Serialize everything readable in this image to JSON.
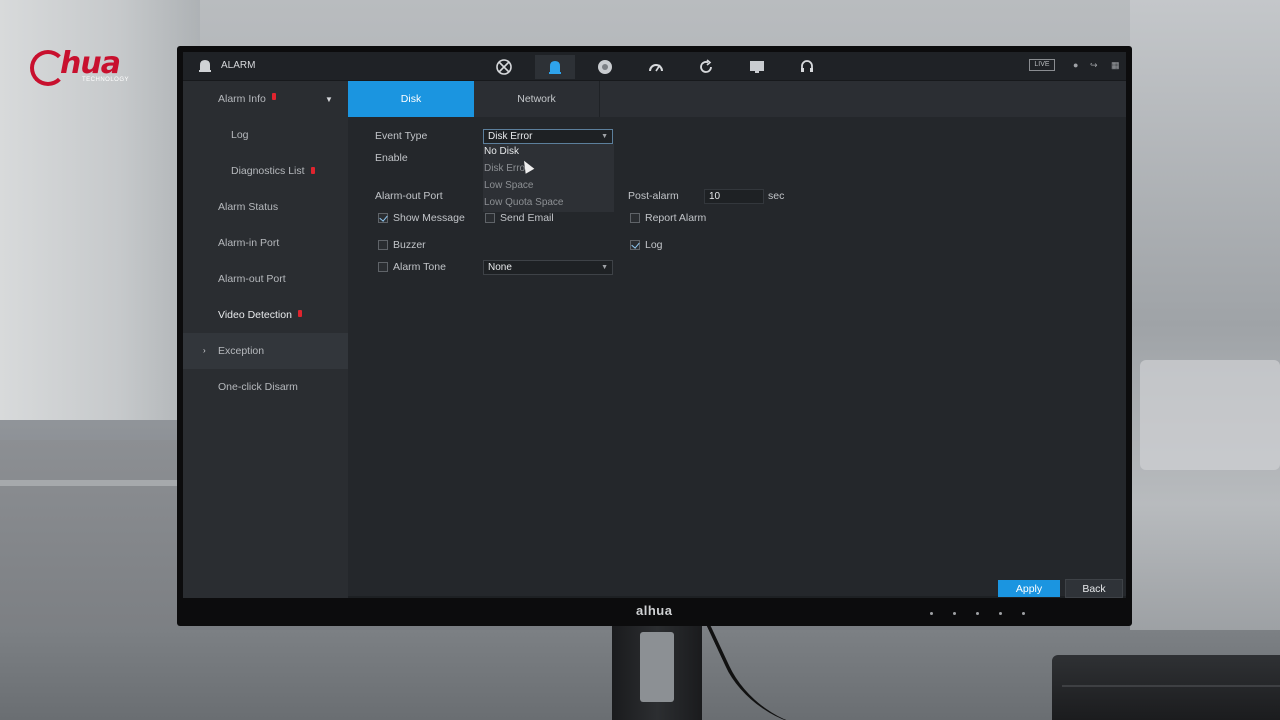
{
  "brand": {
    "name": "hua",
    "sub": "TECHNOLOGY"
  },
  "bezel_logo": "alhua",
  "topbar": {
    "title": "ALARM",
    "live": "LIVE",
    "nav_icons": [
      "network-icon",
      "alarm-icon",
      "info-icon",
      "performance-icon",
      "refresh-icon",
      "display-icon",
      "support-icon"
    ],
    "active_index": 1
  },
  "sidebar": {
    "items": [
      {
        "label": "Alarm Info",
        "badge": true,
        "expanded": true
      },
      {
        "label": "Log",
        "badge": false
      },
      {
        "label": "Diagnostics List",
        "badge": true
      },
      {
        "label": "Alarm Status",
        "badge": false
      },
      {
        "label": "Alarm-in Port",
        "badge": false
      },
      {
        "label": "Alarm-out Port",
        "badge": false
      },
      {
        "label": "Video Detection",
        "badge": true
      },
      {
        "label": "Exception",
        "badge": false,
        "active": true
      },
      {
        "label": "One-click Disarm",
        "badge": false
      }
    ]
  },
  "tabs": [
    {
      "label": "Disk",
      "active": true
    },
    {
      "label": "Network",
      "active": false
    }
  ],
  "form": {
    "event_type_label": "Event Type",
    "event_type_value": "Disk Error",
    "event_type_options": [
      "No Disk",
      "Disk Error",
      "Low Space",
      "Low Quota Space"
    ],
    "enable_label": "Enable",
    "alarm_out_port_label": "Alarm-out Port",
    "post_alarm_label": "Post-alarm",
    "post_alarm_value": "10",
    "post_alarm_unit": "sec",
    "show_message_label": "Show Message",
    "show_message_checked": true,
    "send_email_label": "Send Email",
    "send_email_checked": false,
    "report_alarm_label": "Report Alarm",
    "report_alarm_checked": false,
    "buzzer_label": "Buzzer",
    "buzzer_checked": false,
    "log_label": "Log",
    "log_checked": true,
    "alarm_tone_label": "Alarm Tone",
    "alarm_tone_checked": false,
    "alarm_tone_value": "None"
  },
  "buttons": {
    "apply": "Apply",
    "back": "Back"
  },
  "colors": {
    "accent": "#1b95e0",
    "badge": "#e0242e",
    "brand": "#c8102e"
  }
}
